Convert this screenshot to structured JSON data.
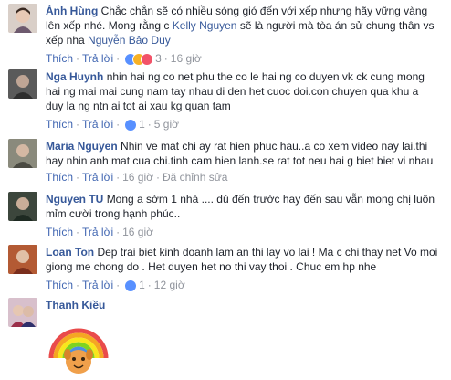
{
  "comments": [
    {
      "author": "Ánh Hùng",
      "text_lines": [
        "Chắc chắn sẽ có nhiều sóng gió đến với xếp nhưng hãy vững vàng",
        "lên xếp nhé. Mong rằng c ",
        "xếp nha "
      ],
      "tag_kelly": "Kelly Nguyen",
      "after_kelly": " sẽ là người mà tòa án sử chung thân vs",
      "tag_bao": "Nguyễn Bảo Duy",
      "like": "Thích",
      "reply": "Trả lời",
      "reactions_count": "3",
      "time": "16 giờ",
      "avatar_color": "#c8b3a6"
    },
    {
      "author": "Nga Huynh",
      "text_lines": [
        "nhin hai ng co net phu the co le hai ng co duyen vk ck cung mong",
        "hai ng mai mai cung nam tay nhau di den het cuoc doi.con chuyen qua khu a",
        "duy la ng ntn ai tot ai xau kg quan tam"
      ],
      "like": "Thích",
      "reply": "Trả lời",
      "reactions_count": "1",
      "time": "5 giờ",
      "avatar_color": "#6b6b6b"
    },
    {
      "author": "Maria Nguyen",
      "text_lines": [
        "Nhin ve mat chi ay rat hien phuc hau..a co xem video nay lai.thi",
        "hay nhin anh mat cua chi.tinh cam hien lanh.se rat tot neu hai g biet biet vi nhau"
      ],
      "like": "Thích",
      "reply": "Trả lời",
      "time": "16 giờ",
      "edited": "Đã chỉnh sửa",
      "avatar_color": "#7a7a6a"
    },
    {
      "author": "Nguyen TU",
      "text_lines": [
        "Mong a sớm 1 nhà .... dù đến trước hay đến sau vẫn mong chị luôn",
        "mỉm cười trong hạnh phúc.."
      ],
      "like": "Thích",
      "reply": "Trả lời",
      "time": "16 giờ",
      "avatar_color": "#3f4a3f"
    },
    {
      "author": "Loan Ton",
      "text_lines": [
        "Dep trai biet kinh doanh lam an thi lay vo lai ! Ma c chi thay net Vo moi",
        "giong me chong do . Het duyen het no thi vay thoi . Chuc em hp nhe"
      ],
      "like": "Thích",
      "reply": "Trả lời",
      "reactions_count": "1",
      "time": "12 giờ",
      "avatar_color": "#a0522d"
    },
    {
      "author": "Thanh Kiều",
      "avatar_color": "#c9a3b5"
    }
  ],
  "colors": {
    "link": "#365899",
    "action": "#4267b2",
    "meta": "#90949c"
  }
}
